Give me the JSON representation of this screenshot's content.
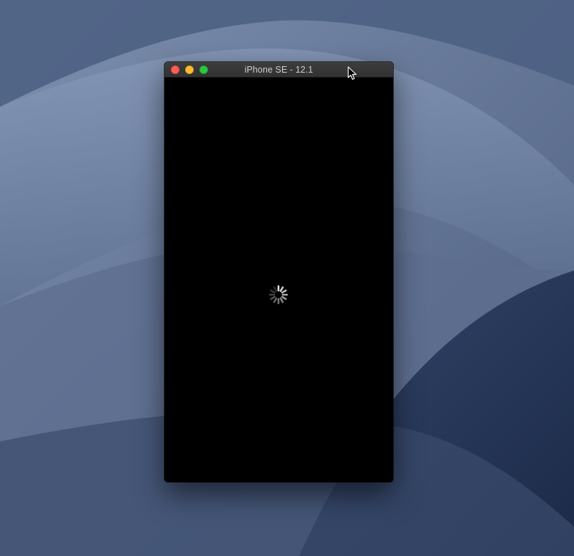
{
  "window": {
    "title": "iPhone SE - 12.1"
  },
  "screen": {
    "state": "loading"
  },
  "colors": {
    "close": "#fc5f57",
    "minimize": "#fdbc2e",
    "zoom": "#28c840",
    "screen_background": "#000000"
  },
  "icons": {
    "spinner": "activity-indicator-icon",
    "cursor": "mouse-pointer-icon"
  }
}
